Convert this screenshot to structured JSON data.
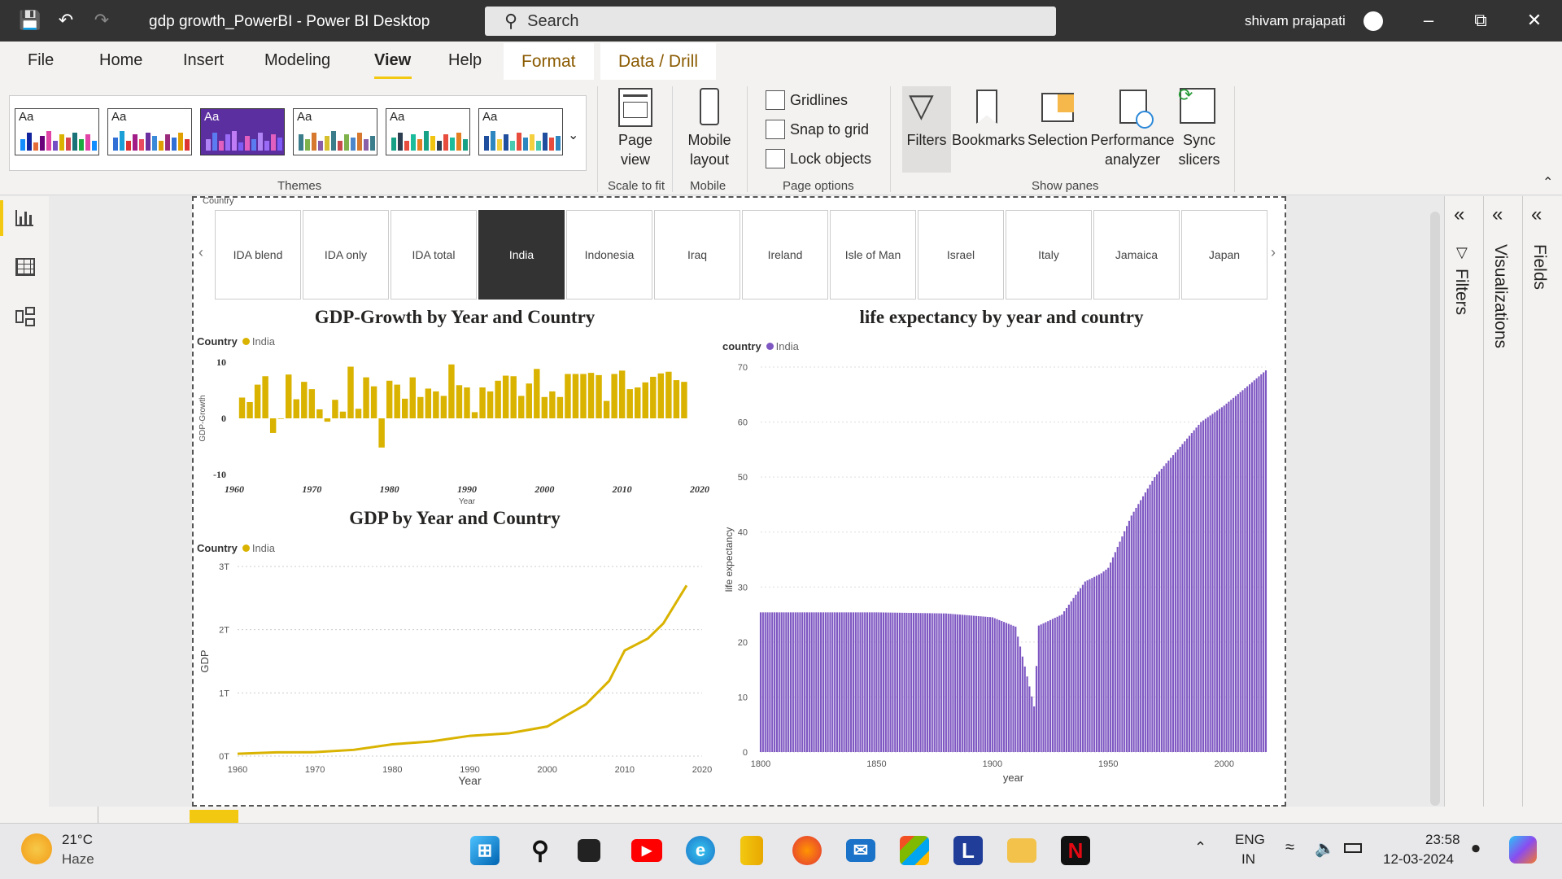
{
  "titlebar": {
    "title": "gdp growth_PowerBI - Power BI Desktop",
    "search_placeholder": "Search",
    "user": "shivam prajapati"
  },
  "menu": {
    "file": "File",
    "home": "Home",
    "insert": "Insert",
    "modeling": "Modeling",
    "view": "View",
    "help": "Help",
    "format": "Format",
    "data_drill": "Data / Drill"
  },
  "ribbon": {
    "themes_label": "Themes",
    "theme_aa": "Aa",
    "page_view": "Page view",
    "scale_label": "Scale to fit",
    "mobile_layout": "Mobile layout",
    "mobile_label": "Mobile",
    "gridlines": "Gridlines",
    "snap_to_grid": "Snap to grid",
    "lock_objects": "Lock objects",
    "page_options_label": "Page options",
    "filters": "Filters",
    "bookmarks": "Bookmarks",
    "selection": "Selection",
    "performance": "Performance analyzer",
    "sync_slicers": "Sync slicers",
    "show_panes_label": "Show panes"
  },
  "slicer": {
    "header": "Country",
    "items": [
      "IDA blend",
      "IDA only",
      "IDA total",
      "India",
      "Indonesia",
      "Iraq",
      "Ireland",
      "Isle of Man",
      "Israel",
      "Italy",
      "Jamaica",
      "Japan"
    ],
    "selected": "India"
  },
  "visuals": {
    "gdp_growth": {
      "title": "GDP-Growth by Year and Country",
      "legend_title": "Country",
      "legend_item": "India",
      "ylabel": "GDP-Growth",
      "xlabel": "Year",
      "yticks": [
        "10",
        "0",
        "-10"
      ],
      "xticks": [
        "1960",
        "1970",
        "1980",
        "1990",
        "2000",
        "2010",
        "2020"
      ]
    },
    "gdp": {
      "title": "GDP by Year and Country",
      "legend_title": "Country",
      "legend_item": "India",
      "ylabel": "GDP",
      "xlabel": "Year",
      "yticks": [
        "3T",
        "2T",
        "1T",
        "0T"
      ],
      "xticks": [
        "1960",
        "1970",
        "1980",
        "1990",
        "2000",
        "2010",
        "2020"
      ]
    },
    "life": {
      "title": "life expectancy by year and country",
      "legend_title": "country",
      "legend_item": "India",
      "ylabel": "life expectancy",
      "xlabel": "year",
      "yticks": [
        "70",
        "60",
        "50",
        "40",
        "30",
        "20",
        "10",
        "0"
      ],
      "xticks": [
        "1800",
        "1850",
        "1900",
        "1950",
        "2000"
      ]
    }
  },
  "panes": {
    "filters": "Filters",
    "visualizations": "Visualizations",
    "fields": "Fields"
  },
  "taskbar": {
    "temp": "21°C",
    "weather": "Haze",
    "lang1": "ENG",
    "lang2": "IN",
    "time": "23:58",
    "date": "12-03-2024"
  },
  "colors": {
    "gold": "#d9b300",
    "purple": "#7e57c2",
    "titlebar": "#333333"
  },
  "chart_data": [
    {
      "type": "bar",
      "title": "GDP-Growth by Year and Country",
      "xlabel": "Year",
      "ylabel": "GDP-Growth",
      "ylim": [
        -10,
        10
      ],
      "series": [
        {
          "name": "India",
          "x": [
            1961,
            1962,
            1963,
            1964,
            1965,
            1966,
            1967,
            1968,
            1969,
            1970,
            1971,
            1972,
            1973,
            1974,
            1975,
            1976,
            1977,
            1978,
            1979,
            1980,
            1981,
            1982,
            1983,
            1984,
            1985,
            1986,
            1987,
            1988,
            1989,
            1990,
            1991,
            1992,
            1993,
            1994,
            1995,
            1996,
            1997,
            1998,
            1999,
            2000,
            2001,
            2002,
            2003,
            2004,
            2005,
            2006,
            2007,
            2008,
            2009,
            2010,
            2011,
            2012,
            2013,
            2014,
            2015,
            2016,
            2017,
            2018
          ],
          "values": [
            3.7,
            2.9,
            6.0,
            7.5,
            -2.6,
            -0.1,
            7.8,
            3.4,
            6.5,
            5.2,
            1.6,
            -0.6,
            3.3,
            1.2,
            9.2,
            1.7,
            7.3,
            5.7,
            -5.2,
            6.7,
            6.0,
            3.5,
            7.3,
            3.8,
            5.3,
            4.8,
            4.0,
            9.6,
            5.9,
            5.5,
            1.1,
            5.5,
            4.8,
            6.7,
            7.6,
            7.5,
            4.0,
            6.2,
            8.8,
            3.8,
            4.8,
            3.8,
            7.9,
            7.9,
            7.9,
            8.1,
            7.7,
            3.1,
            7.9,
            8.5,
            5.2,
            5.5,
            6.4,
            7.4,
            8.0,
            8.3,
            6.8,
            6.5
          ]
        }
      ]
    },
    {
      "type": "line",
      "title": "GDP by Year and Country",
      "xlabel": "Year",
      "ylabel": "GDP",
      "ylim": [
        0,
        3000000000000
      ],
      "series": [
        {
          "name": "India",
          "x": [
            1960,
            1965,
            1970,
            1975,
            1980,
            1985,
            1990,
            1995,
            2000,
            2005,
            2008,
            2010,
            2013,
            2015,
            2018
          ],
          "values": [
            37000000000,
            59000000000,
            62000000000,
            99000000000,
            186000000000,
            232000000000,
            321000000000,
            360000000000,
            468000000000,
            820000000000,
            1190000000000,
            1670000000000,
            1860000000000,
            2100000000000,
            2700000000000
          ]
        }
      ]
    },
    {
      "type": "bar",
      "title": "life expectancy by year and country",
      "xlabel": "year",
      "ylabel": "life expectancy",
      "ylim": [
        0,
        70
      ],
      "series": [
        {
          "name": "India",
          "x_range": [
            1800,
            2018
          ],
          "anchors": [
            [
              1800,
              25.4
            ],
            [
              1850,
              25.4
            ],
            [
              1880,
              25.2
            ],
            [
              1900,
              24.5
            ],
            [
              1910,
              22.8
            ],
            [
              1918,
              8.3
            ],
            [
              1920,
              23.0
            ],
            [
              1930,
              25.0
            ],
            [
              1940,
              31.0
            ],
            [
              1947,
              32.5
            ],
            [
              1950,
              33.5
            ],
            [
              1960,
              43.0
            ],
            [
              1970,
              50.0
            ],
            [
              1980,
              55.0
            ],
            [
              1990,
              60.0
            ],
            [
              2000,
              63.0
            ],
            [
              2010,
              66.5
            ],
            [
              2018,
              69.4
            ]
          ]
        }
      ]
    }
  ]
}
